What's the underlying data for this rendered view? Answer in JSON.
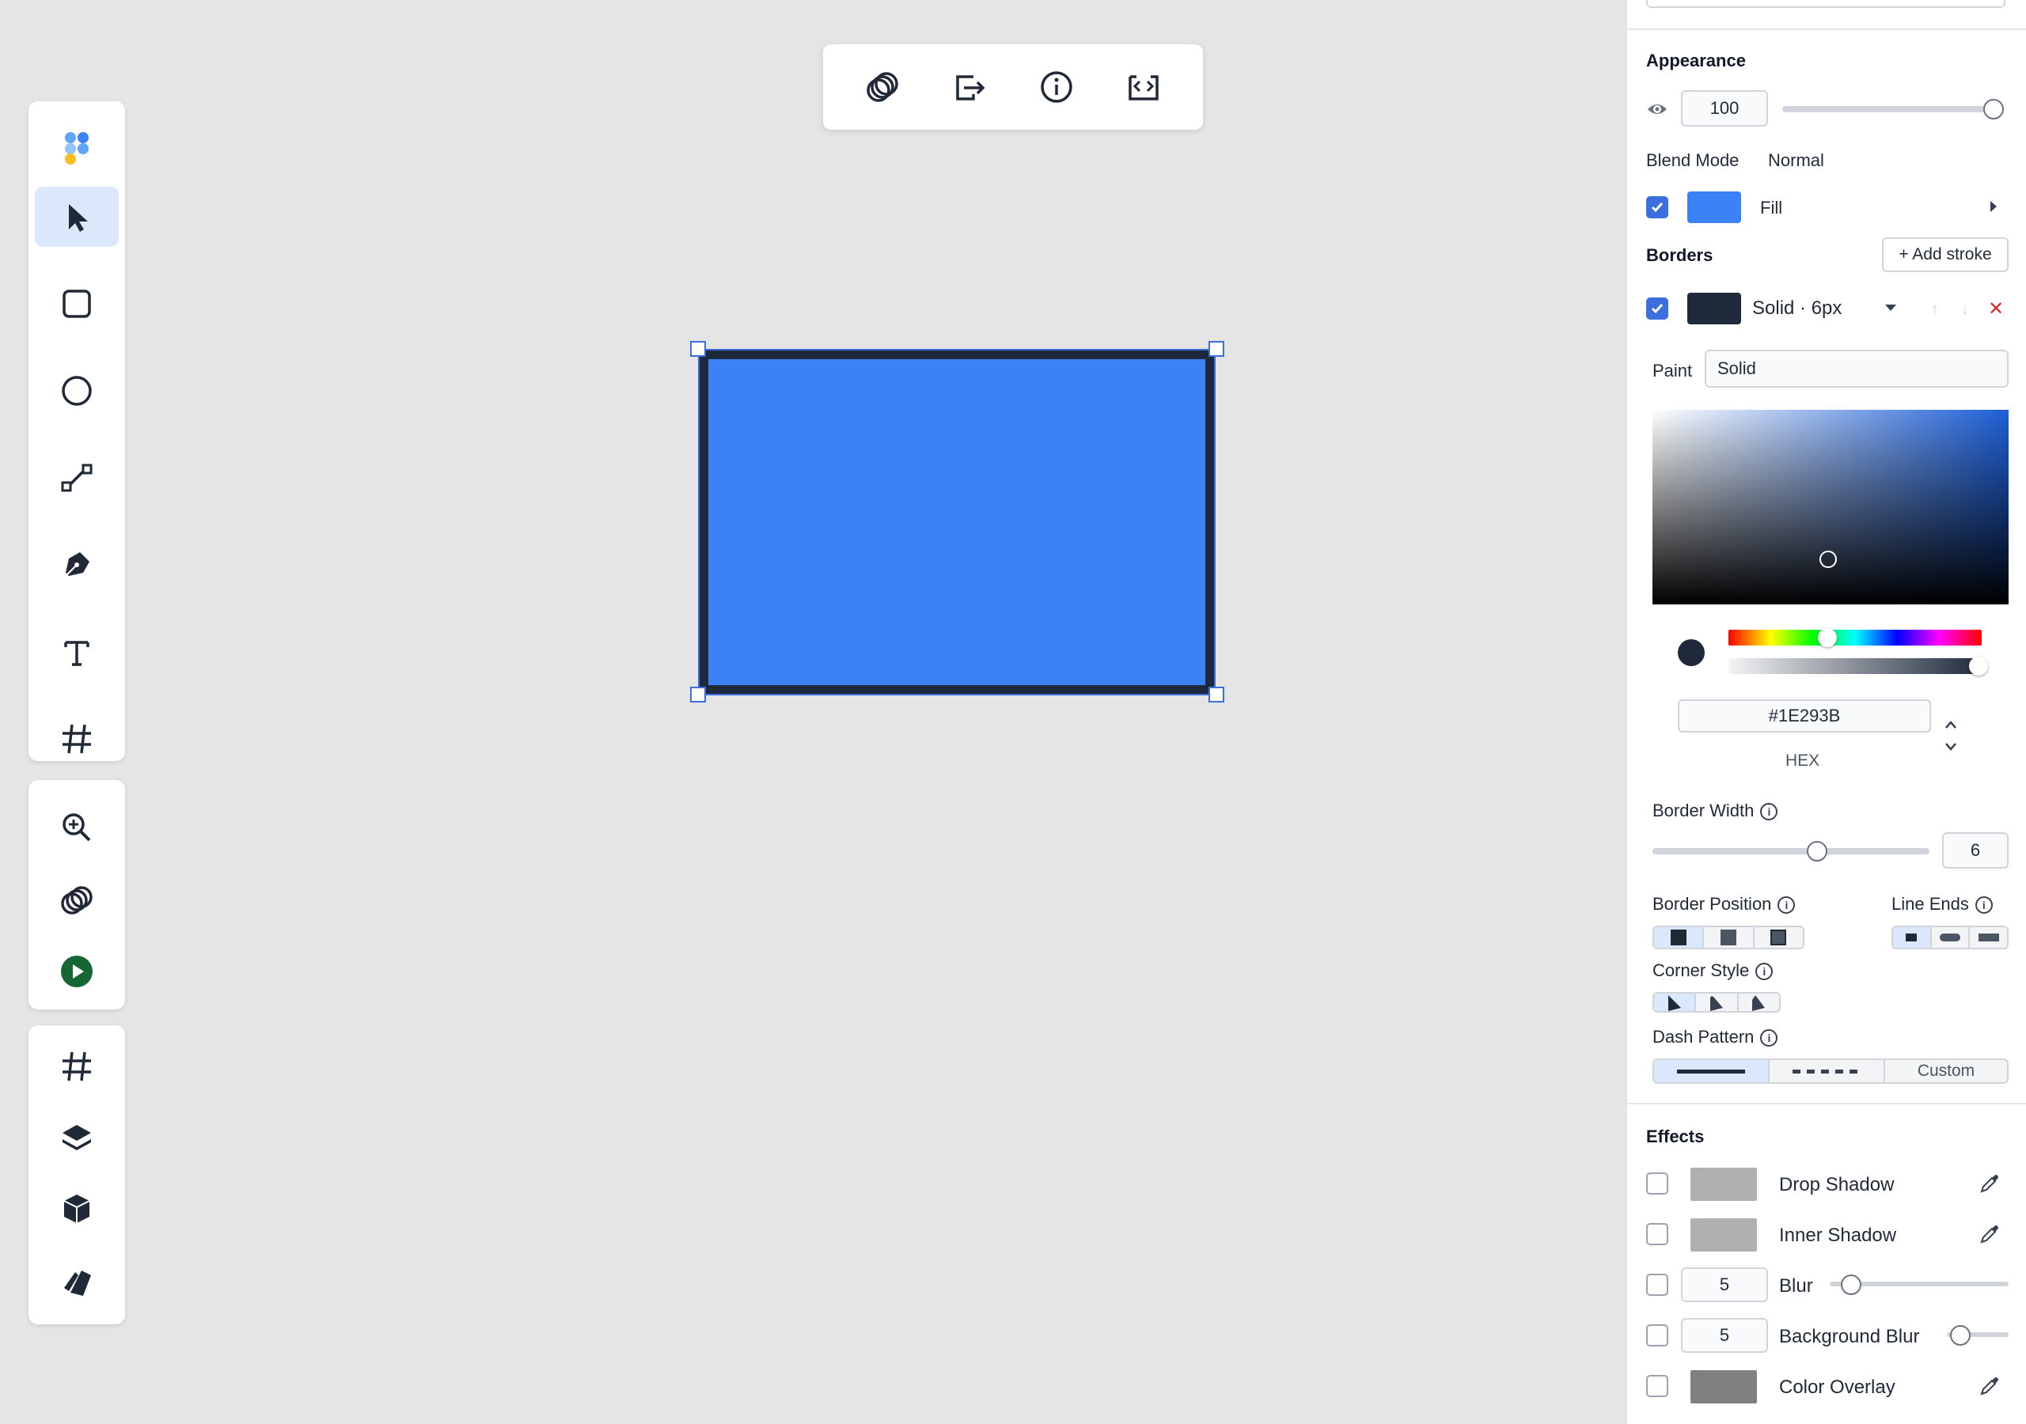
{
  "appearance": {
    "title": "Appearance",
    "opacity": "100",
    "opacity_level": 1.0,
    "blend_mode_label": "Blend Mode",
    "blend_mode_value": "Normal",
    "fill_label": "Fill",
    "fill_color": "#3B82F6"
  },
  "borders": {
    "title": "Borders",
    "add_stroke": "+ Add stroke",
    "stroke_summary": "Solid · 6px",
    "stroke_color": "#1E293B",
    "paint_label": "Paint",
    "paint_value": "Solid",
    "hex_value": "#1E293B",
    "hex_label": "HEX",
    "border_width_label": "Border Width",
    "border_width_value": "6",
    "border_position_label": "Border Position",
    "line_ends_label": "Line Ends",
    "corner_style_label": "Corner Style",
    "dash_pattern_label": "Dash Pattern",
    "dash_custom": "Custom"
  },
  "effects": {
    "title": "Effects",
    "drop_shadow": "Drop Shadow",
    "inner_shadow": "Inner Shadow",
    "blur_value": "5",
    "blur_label": "Blur",
    "bg_blur_value": "5",
    "bg_blur_label": "Background Blur",
    "color_overlay": "Color Overlay"
  },
  "icons": {
    "left_tools": [
      "logo-icon",
      "select-arrow-icon",
      "rectangle-icon",
      "ellipse-icon",
      "line-icon",
      "pen-icon",
      "text-icon",
      "frame-icon",
      "hand-icon"
    ],
    "left_tools_2": [
      "zoom-icon",
      "boolean-icon",
      "play-icon"
    ],
    "left_tools_3": [
      "grid-icon",
      "layers-icon",
      "components-icon",
      "assets-icon"
    ],
    "top_toolbar": [
      "boolean-icon",
      "export-icon",
      "info-icon",
      "code-icon"
    ]
  },
  "colors": {
    "accent": "#3B6FE0",
    "shape_fill": "#3B82F6",
    "shape_stroke": "#1E293B"
  }
}
